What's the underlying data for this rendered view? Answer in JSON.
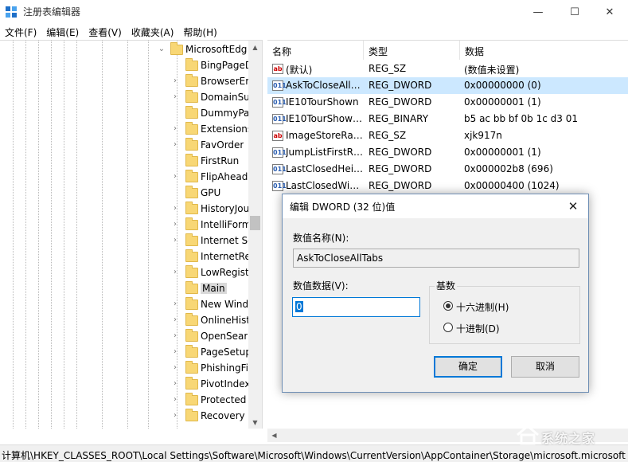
{
  "window": {
    "title": "注册表编辑器",
    "min_glyph": "—",
    "max_glyph": "☐",
    "close_glyph": "✕"
  },
  "menu": [
    "文件(F)",
    "编辑(E)",
    "查看(V)",
    "收藏夹(A)",
    "帮助(H)"
  ],
  "tree": {
    "items": [
      {
        "label": "MicrosoftEdg",
        "expanded": true,
        "selected": false
      },
      {
        "label": "BingPageD",
        "expanded": false,
        "selected": false,
        "has_children": false
      },
      {
        "label": "BrowserEm",
        "expanded": false,
        "selected": false,
        "has_children": true
      },
      {
        "label": "DomainSu",
        "expanded": false,
        "selected": false,
        "has_children": true
      },
      {
        "label": "DummyPat",
        "expanded": false,
        "selected": false,
        "has_children": false
      },
      {
        "label": "Extensions",
        "expanded": false,
        "selected": false,
        "has_children": true
      },
      {
        "label": "FavOrder",
        "expanded": false,
        "selected": false,
        "has_children": true
      },
      {
        "label": "FirstRun",
        "expanded": false,
        "selected": false,
        "has_children": false
      },
      {
        "label": "FlipAhead",
        "expanded": false,
        "selected": false,
        "has_children": true
      },
      {
        "label": "GPU",
        "expanded": false,
        "selected": false,
        "has_children": false
      },
      {
        "label": "HistoryJou",
        "expanded": false,
        "selected": false,
        "has_children": true
      },
      {
        "label": "IntelliForm",
        "expanded": false,
        "selected": false,
        "has_children": true
      },
      {
        "label": "Internet Se",
        "expanded": false,
        "selected": false,
        "has_children": true
      },
      {
        "label": "InternetRe",
        "expanded": false,
        "selected": false,
        "has_children": false
      },
      {
        "label": "LowRegist",
        "expanded": false,
        "selected": false,
        "has_children": true
      },
      {
        "label": "Main",
        "expanded": false,
        "selected": true,
        "has_children": false
      },
      {
        "label": "New Wind",
        "expanded": false,
        "selected": false,
        "has_children": true
      },
      {
        "label": "OnlineHist",
        "expanded": false,
        "selected": false,
        "has_children": true
      },
      {
        "label": "OpenSear",
        "expanded": false,
        "selected": false,
        "has_children": true
      },
      {
        "label": "PageSetup",
        "expanded": false,
        "selected": false,
        "has_children": true
      },
      {
        "label": "PhishingFil",
        "expanded": false,
        "selected": false,
        "has_children": true
      },
      {
        "label": "PivotIndex",
        "expanded": false,
        "selected": false,
        "has_children": true
      },
      {
        "label": "Protected",
        "expanded": false,
        "selected": false,
        "has_children": true
      },
      {
        "label": "Recovery",
        "expanded": false,
        "selected": false,
        "has_children": true
      }
    ]
  },
  "values": {
    "headers": [
      "名称",
      "类型",
      "数据"
    ],
    "rows": [
      {
        "icon": "string-value-icon",
        "icon_text": "ab",
        "name": "(默认)",
        "type": "REG_SZ",
        "data": "(数值未设置)",
        "selected": false
      },
      {
        "icon": "binary-value-icon",
        "icon_text": "011",
        "name": "AskToCloseAll…",
        "type": "REG_DWORD",
        "data": "0x00000000 (0)",
        "selected": true
      },
      {
        "icon": "binary-value-icon",
        "icon_text": "011",
        "name": "IE10TourShown",
        "type": "REG_DWORD",
        "data": "0x00000001 (1)",
        "selected": false
      },
      {
        "icon": "binary-value-icon",
        "icon_text": "011",
        "name": "IE10TourShow…",
        "type": "REG_BINARY",
        "data": "b5 ac bb bf 0b 1c d3 01",
        "selected": false
      },
      {
        "icon": "string-value-icon",
        "icon_text": "ab",
        "name": "ImageStoreRa…",
        "type": "REG_SZ",
        "data": "xjk917n",
        "selected": false
      },
      {
        "icon": "binary-value-icon",
        "icon_text": "011",
        "name": "JumpListFirstR…",
        "type": "REG_DWORD",
        "data": "0x00000001 (1)",
        "selected": false
      },
      {
        "icon": "binary-value-icon",
        "icon_text": "011",
        "name": "LastClosedHei…",
        "type": "REG_DWORD",
        "data": "0x000002b8 (696)",
        "selected": false
      },
      {
        "icon": "binary-value-icon",
        "icon_text": "011",
        "name": "LastClosedWi…",
        "type": "REG_DWORD",
        "data": "0x00000400 (1024)",
        "selected": false
      }
    ]
  },
  "statusbar": {
    "path": "计算机\\HKEY_CLASSES_ROOT\\Local Settings\\Software\\Microsoft\\Windows\\CurrentVersion\\AppContainer\\Storage\\microsoft.microsoft"
  },
  "dialog": {
    "title": "编辑 DWORD (32 位)值",
    "close_glyph": "✕",
    "name_label": "数值名称(N):",
    "name_value": "AskToCloseAllTabs",
    "data_label": "数值数据(V):",
    "data_value": "0",
    "base_label": "基数",
    "radio_hex": "十六进制(H)",
    "radio_dec": "十进制(D)",
    "selected_base": "hex",
    "ok_label": "确定",
    "cancel_label": "取消"
  },
  "watermark": {
    "text": "系统之家"
  },
  "colors": {
    "selection": "#cce8ff",
    "accent": "#0078d7",
    "folder": "#f8d775"
  }
}
